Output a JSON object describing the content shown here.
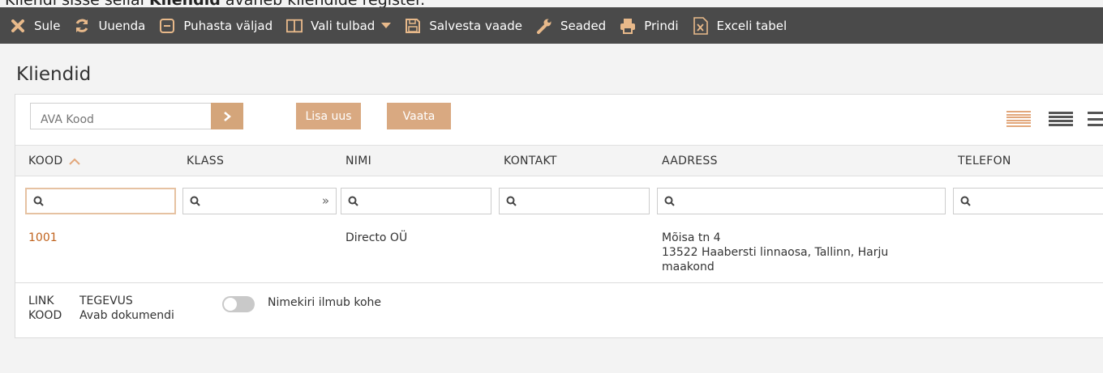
{
  "caption": {
    "prefix": "Kliendi",
    "text_a": " sisse sellal ",
    "bold": "Kliendid",
    "text_b": " avaneb kliendide register."
  },
  "toolbar": {
    "items": [
      {
        "label": "Sule",
        "icon": "close-icon"
      },
      {
        "label": "Uuenda",
        "icon": "refresh-icon"
      },
      {
        "label": "Puhasta väljad",
        "icon": "clear-icon"
      },
      {
        "label": "Vali tulbad",
        "icon": "columns-icon"
      },
      {
        "label": "Salvesta vaade",
        "icon": "save-icon"
      },
      {
        "label": "Seaded",
        "icon": "wrench-icon"
      },
      {
        "label": "Prindi",
        "icon": "print-icon"
      },
      {
        "label": "Exceli tabel",
        "icon": "excel-icon"
      }
    ]
  },
  "page": {
    "title": "Kliendid"
  },
  "search": {
    "placeholder": "AVA Kood"
  },
  "buttons": {
    "add": "Lisa uus",
    "view": "Vaata"
  },
  "columns": [
    "KOOD",
    "KLASS",
    "NIMI",
    "KONTAKT",
    "AADRESS",
    "TELEFON"
  ],
  "rows": [
    {
      "kood": "1001",
      "klass": "",
      "nimi": "Directo OÜ",
      "kontakt": "",
      "aadress": [
        "Mõisa tn 4",
        "13522 Haabersti linnaosa, Tallinn, Harju",
        "maakond"
      ],
      "telefon": ""
    }
  ],
  "legend": {
    "col1": [
      "LINK",
      "KOOD"
    ],
    "col2": [
      "TEGEVUS",
      "Avab dokumendi"
    ],
    "toggle_label": "Nimekiri ilmub kohe"
  },
  "colors": {
    "toolbar_bg": "#4a4a4a",
    "accent": "#d9a981",
    "link": "#c0621c",
    "toolbar_icon": "#e8b98a"
  }
}
